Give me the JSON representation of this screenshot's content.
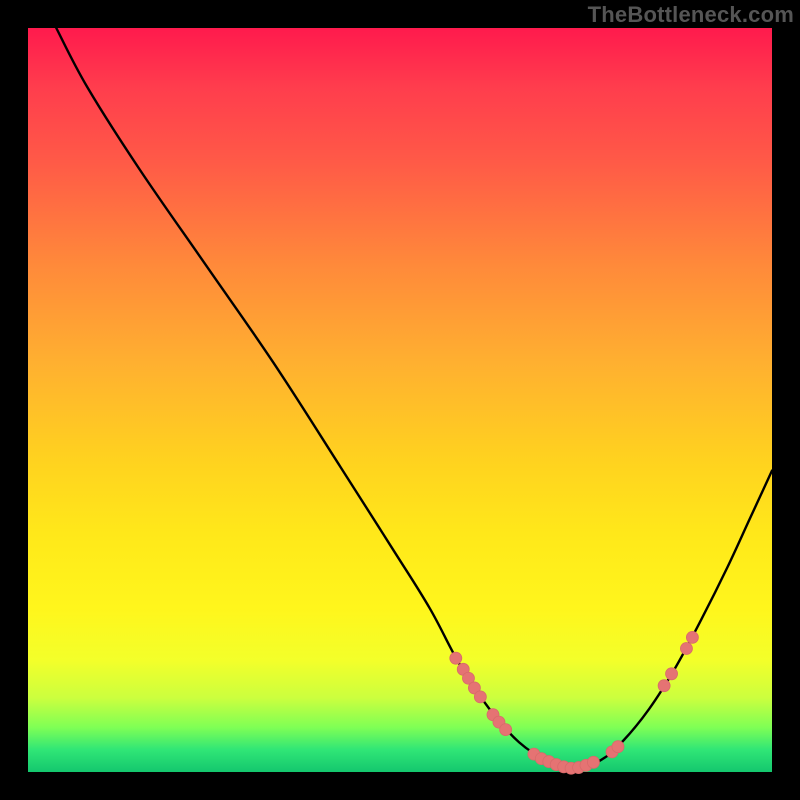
{
  "watermark": "TheBottleneck.com",
  "colors": {
    "curve": "#000000",
    "marker_fill": "#e57373",
    "marker_stroke": "#d86a6a",
    "background": "#000000"
  },
  "chart_data": {
    "type": "line",
    "title": "",
    "xlabel": "",
    "ylabel": "",
    "xlim": [
      0,
      100
    ],
    "ylim": [
      0,
      100
    ],
    "curve": [
      {
        "x": 3.8,
        "y": 100.0
      },
      {
        "x": 8.0,
        "y": 92.0
      },
      {
        "x": 15.0,
        "y": 81.0
      },
      {
        "x": 24.0,
        "y": 68.0
      },
      {
        "x": 33.0,
        "y": 55.0
      },
      {
        "x": 42.0,
        "y": 41.0
      },
      {
        "x": 49.0,
        "y": 30.0
      },
      {
        "x": 54.0,
        "y": 22.0
      },
      {
        "x": 58.0,
        "y": 14.5
      },
      {
        "x": 62.0,
        "y": 8.5
      },
      {
        "x": 66.0,
        "y": 4.0
      },
      {
        "x": 70.0,
        "y": 1.4
      },
      {
        "x": 73.5,
        "y": 0.5
      },
      {
        "x": 77.0,
        "y": 1.6
      },
      {
        "x": 80.0,
        "y": 4.2
      },
      {
        "x": 83.5,
        "y": 8.5
      },
      {
        "x": 87.0,
        "y": 14.0
      },
      {
        "x": 90.5,
        "y": 20.5
      },
      {
        "x": 94.0,
        "y": 27.5
      },
      {
        "x": 97.0,
        "y": 34.0
      },
      {
        "x": 100.0,
        "y": 40.5
      }
    ],
    "markers": [
      {
        "x": 57.5,
        "y": 15.3
      },
      {
        "x": 58.5,
        "y": 13.8
      },
      {
        "x": 59.2,
        "y": 12.6
      },
      {
        "x": 60.0,
        "y": 11.3
      },
      {
        "x": 60.8,
        "y": 10.1
      },
      {
        "x": 62.5,
        "y": 7.7
      },
      {
        "x": 63.3,
        "y": 6.7
      },
      {
        "x": 64.2,
        "y": 5.7
      },
      {
        "x": 68.0,
        "y": 2.4
      },
      {
        "x": 69.0,
        "y": 1.8
      },
      {
        "x": 70.0,
        "y": 1.4
      },
      {
        "x": 71.0,
        "y": 1.0
      },
      {
        "x": 72.0,
        "y": 0.7
      },
      {
        "x": 73.0,
        "y": 0.5
      },
      {
        "x": 74.0,
        "y": 0.6
      },
      {
        "x": 75.0,
        "y": 0.9
      },
      {
        "x": 76.0,
        "y": 1.3
      },
      {
        "x": 78.5,
        "y": 2.7
      },
      {
        "x": 79.3,
        "y": 3.4
      },
      {
        "x": 85.5,
        "y": 11.6
      },
      {
        "x": 86.5,
        "y": 13.2
      },
      {
        "x": 88.5,
        "y": 16.6
      },
      {
        "x": 89.3,
        "y": 18.1
      }
    ],
    "marker_radius": 6
  }
}
